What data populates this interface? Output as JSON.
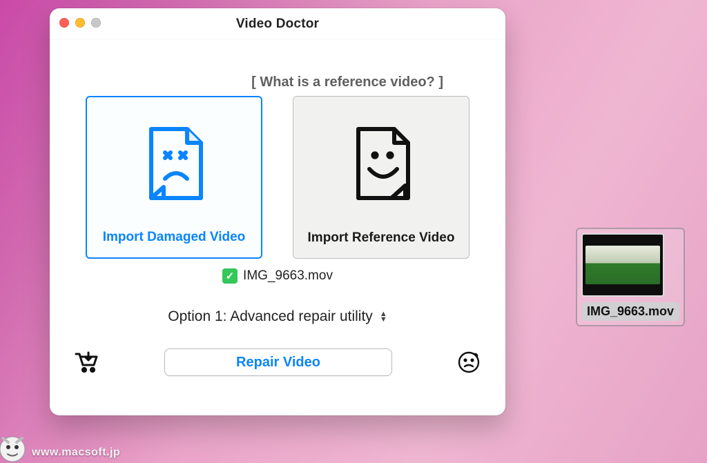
{
  "window": {
    "title": "Video Doctor"
  },
  "hint": {
    "reference": "[ What is a reference video? ]"
  },
  "dropzones": {
    "damaged": {
      "label": "Import Damaged Video"
    },
    "reference": {
      "label": "Import Reference Video"
    }
  },
  "imported": {
    "filename": "IMG_9663.mov"
  },
  "option": {
    "label": "Option 1: Advanced repair utility"
  },
  "buttons": {
    "repair": "Repair Video"
  },
  "desktop": {
    "filename": "IMG_9663.mov"
  },
  "watermark": "www.macsoft.jp",
  "icons": {
    "damaged_file": "damaged-file-icon",
    "happy_file": "happy-file-icon",
    "cart": "shopping-cart-icon",
    "help_face": "confused-face-icon",
    "check": "check-icon",
    "stepper": "updown-stepper-icon"
  }
}
